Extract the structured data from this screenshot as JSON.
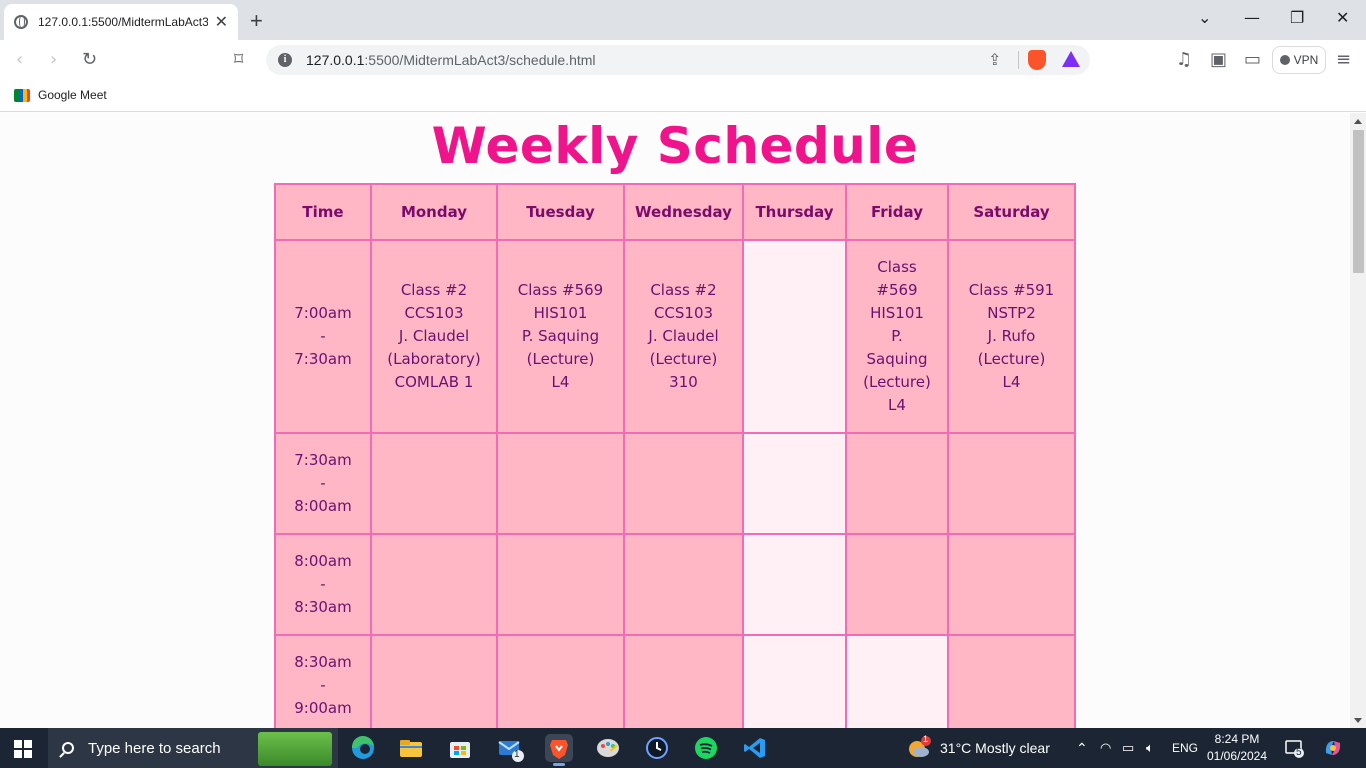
{
  "browser": {
    "tab_title": "127.0.0.1:5500/MidtermLabAct3",
    "new_tab": "+",
    "url_host": "127.0.0.1",
    "url_rest": ":5500/MidtermLabAct3/schedule.html",
    "vpn_label": "VPN",
    "bookmark": "Google Meet"
  },
  "page": {
    "title": "Weekly Schedule"
  },
  "schedule": {
    "headers": [
      "Time",
      "Monday",
      "Tuesday",
      "Wednesday",
      "Thursday",
      "Friday",
      "Saturday"
    ],
    "rows": [
      {
        "time": [
          "7:00am",
          "-",
          "7:30am"
        ],
        "cells": [
          [
            "Class #2",
            "CCS103",
            "J. Claudel",
            "(Laboratory)",
            "COMLAB 1"
          ],
          [
            "Class #569",
            "HIS101",
            "P. Saquing",
            "(Lecture)",
            "L4"
          ],
          [
            "Class #2",
            "CCS103",
            "J. Claudel",
            "(Lecture)",
            "310"
          ],
          [],
          [
            "Class",
            "#569",
            "HIS101",
            "P.",
            "Saquing",
            "(Lecture)",
            "L4"
          ],
          [
            "Class #591",
            "NSTP2",
            "J. Rufo",
            "(Lecture)",
            "L4"
          ]
        ]
      },
      {
        "time": [
          "7:30am",
          "-",
          "8:00am"
        ]
      },
      {
        "time": [
          "8:00am",
          "-",
          "8:30am"
        ]
      },
      {
        "time": [
          "8:30am",
          "-",
          "9:00am"
        ]
      }
    ]
  },
  "taskbar": {
    "search_placeholder": "Type here to search",
    "weather": "31°C  Mostly clear",
    "language": "ENG",
    "time": "8:24 PM",
    "date": "01/06/2024",
    "notifications": "5",
    "mail_badge": "1",
    "weather_badge": "1"
  }
}
